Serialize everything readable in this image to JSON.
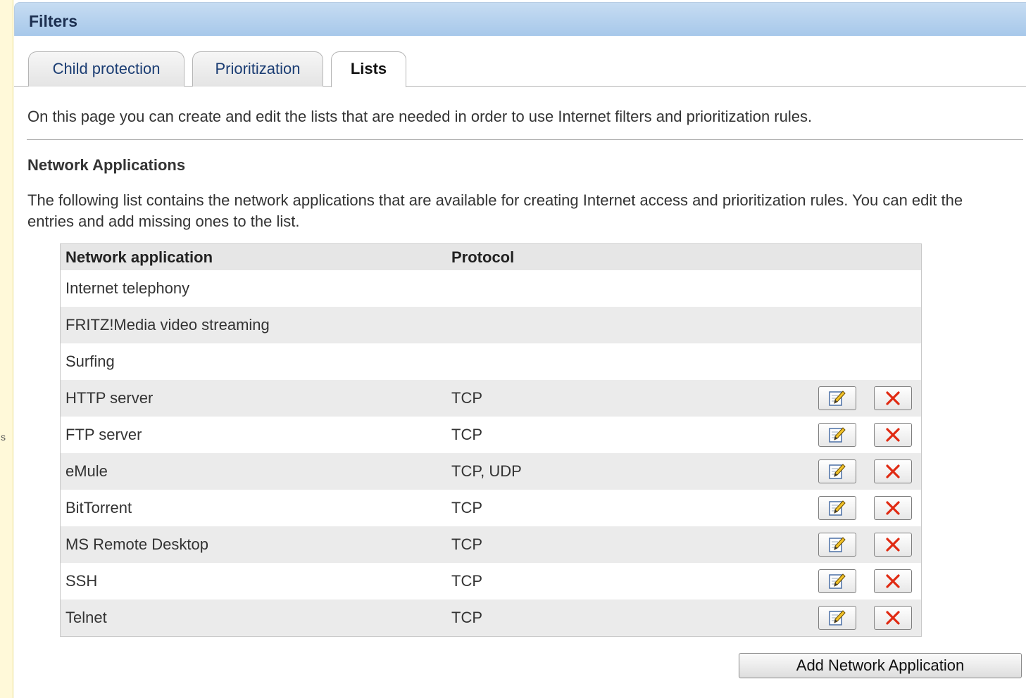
{
  "sidebar": {
    "partial_text": "s"
  },
  "header": {
    "title": "Filters"
  },
  "tabs": [
    {
      "label": "Child protection",
      "active": false
    },
    {
      "label": "Prioritization",
      "active": false
    },
    {
      "label": "Lists",
      "active": true
    }
  ],
  "intro_text": "On this page you can create and edit the lists that are needed in order to use Internet filters and prioritization rules.",
  "section": {
    "title": "Network Applications",
    "description": "The following list contains the network applications that are available for creating Internet access and prioritization rules. You can edit the entries and add missing ones to the list."
  },
  "table": {
    "columns": [
      "Network application",
      "Protocol"
    ],
    "rows": [
      {
        "application": "Internet telephony",
        "protocol": "",
        "editable": false
      },
      {
        "application": "FRITZ!Media video streaming",
        "protocol": "",
        "editable": false
      },
      {
        "application": "Surfing",
        "protocol": "",
        "editable": false
      },
      {
        "application": "HTTP server",
        "protocol": "TCP",
        "editable": true
      },
      {
        "application": "FTP server",
        "protocol": "TCP",
        "editable": true
      },
      {
        "application": "eMule",
        "protocol": "TCP, UDP",
        "editable": true
      },
      {
        "application": "BitTorrent",
        "protocol": "TCP",
        "editable": true
      },
      {
        "application": "MS Remote Desktop",
        "protocol": "TCP",
        "editable": true
      },
      {
        "application": "SSH",
        "protocol": "TCP",
        "editable": true
      },
      {
        "application": "Telnet",
        "protocol": "TCP",
        "editable": true
      }
    ]
  },
  "icons": {
    "edit": "edit-icon",
    "delete": "delete-icon"
  },
  "colors": {
    "header_bar": "#a7c8ea",
    "delete_red": "#e02a12",
    "tab_text": "#1b3d73"
  },
  "add_button_label": "Add Network Application"
}
